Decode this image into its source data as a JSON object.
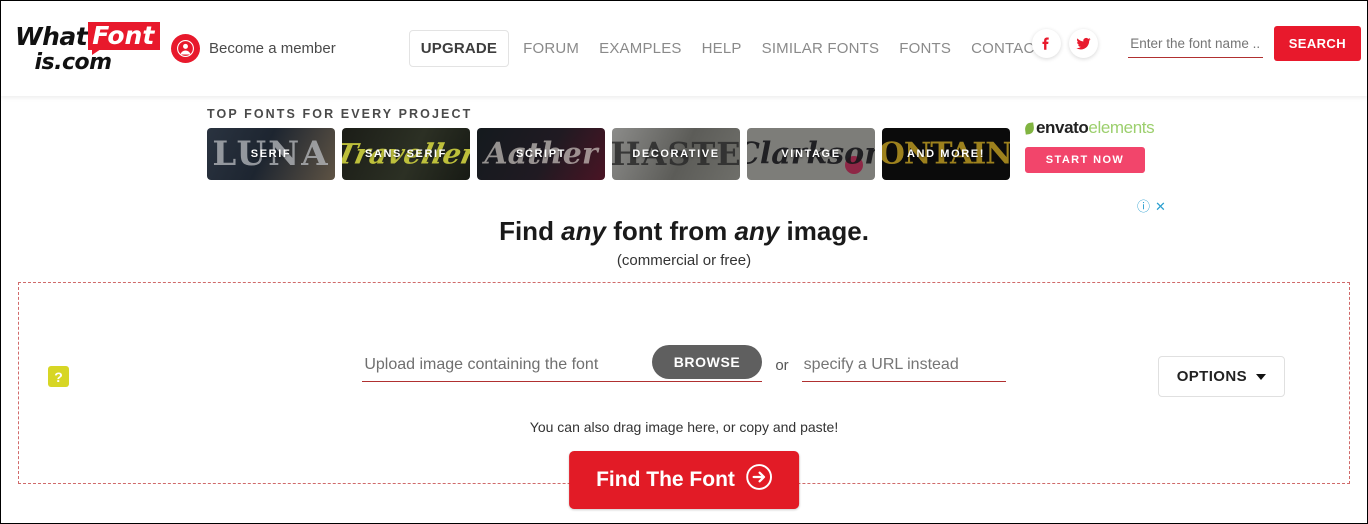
{
  "header": {
    "logo": {
      "part1": "What",
      "part2": "Font",
      "part3": "is.com"
    },
    "member_label": "Become a member",
    "nav": [
      {
        "label": "UPGRADE",
        "name": "nav-upgrade",
        "highlight": true
      },
      {
        "label": "FORUM",
        "name": "nav-forum",
        "highlight": false
      },
      {
        "label": "EXAMPLES",
        "name": "nav-examples",
        "highlight": false
      },
      {
        "label": "HELP",
        "name": "nav-help",
        "highlight": false
      },
      {
        "label": "SIMILAR FONTS",
        "name": "nav-similar-fonts",
        "highlight": false
      },
      {
        "label": "FONTS",
        "name": "nav-fonts",
        "highlight": false
      },
      {
        "label": "CONTACT",
        "name": "nav-contact",
        "highlight": false
      }
    ],
    "social": [
      {
        "icon": "facebook-icon",
        "color": "#e8192c"
      },
      {
        "icon": "twitter-icon",
        "color": "#e8192c"
      }
    ],
    "search": {
      "placeholder": "Enter the font name ...",
      "value": "",
      "button_label": "SEARCH",
      "button_color": "#e8192c"
    }
  },
  "promo": {
    "title": "TOP FONTS FOR EVERY PROJECT",
    "cards": [
      {
        "label": "SERIF",
        "ghost": "LUNA",
        "class": "c-serif"
      },
      {
        "label": "SANS SERIF",
        "ghost": "Traveller",
        "class": "c-sans"
      },
      {
        "label": "SCRIPT",
        "ghost": "Aather",
        "class": "c-script"
      },
      {
        "label": "DECORATIVE",
        "ghost": "HASTE",
        "class": "c-deco"
      },
      {
        "label": "VINTAGE",
        "ghost": "Clarkson",
        "class": "c-vint"
      },
      {
        "label": "AND MORE!",
        "ghost": "FONTAINE",
        "class": "c-more"
      }
    ],
    "ad": {
      "brand_dark": "envato",
      "brand_light": "elements",
      "cta_label": "START NOW",
      "cta_color": "#f2456b",
      "info_icon": "ⓘ",
      "close_icon": "✕",
      "icon_color": "#2a9fd0"
    }
  },
  "hero": {
    "title_a": "Find ",
    "title_em1": "any",
    "title_b": " font from ",
    "title_em2": "any",
    "title_c": " image.",
    "subtitle": "(commercial or free)"
  },
  "dropzone": {
    "help_badge": "?",
    "help_badge_color": "#d7d625",
    "upload_placeholder": "Upload image containing the font",
    "browse_label": "BROWSE",
    "or_label": "or",
    "url_placeholder": "specify a URL instead",
    "url_value": "",
    "options_label": "OPTIONS",
    "drag_note": "You can also drag image here, or copy and paste!",
    "find_label": "Find The Font",
    "find_color": "#e21b26",
    "border_color": "#d06a6a"
  }
}
